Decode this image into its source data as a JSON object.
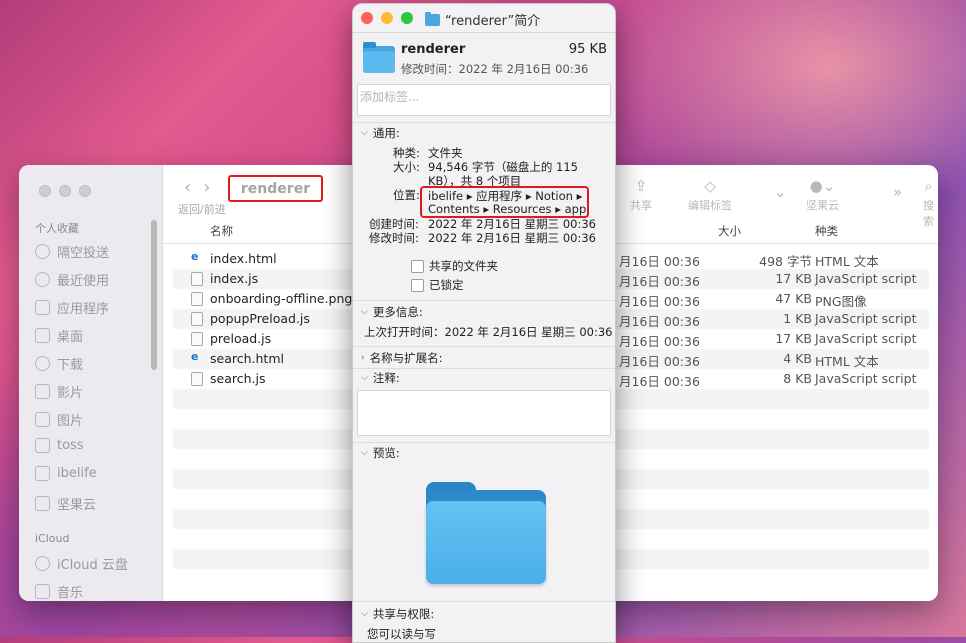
{
  "finder": {
    "title": "renderer",
    "nav_label": "返回/前进",
    "toolbar": {
      "share": "共享",
      "tags": "编辑标签",
      "cloud": "坚果云",
      "search": "搜索"
    },
    "sidebar": {
      "favorites_header": "个人收藏",
      "favorites": [
        "隔空投送",
        "最近使用",
        "应用程序",
        "桌面",
        "下载",
        "影片",
        "图片",
        "toss",
        "ibelife",
        "坚果云"
      ],
      "icloud_header": "iCloud",
      "icloud": [
        "iCloud 云盘",
        "音乐"
      ]
    },
    "columns": {
      "name": "名称",
      "size": "大小",
      "kind": "种类"
    },
    "files": [
      {
        "name": "index.html",
        "date": "月16日 00:36",
        "size": "498 字节",
        "kind": "HTML 文本"
      },
      {
        "name": "index.js",
        "date": "月16日 00:36",
        "size": "17 KB",
        "kind": "JavaScript script"
      },
      {
        "name": "onboarding-offline.png",
        "date": "月16日 00:36",
        "size": "47 KB",
        "kind": "PNG图像"
      },
      {
        "name": "popupPreload.js",
        "date": "月16日 00:36",
        "size": "1 KB",
        "kind": "JavaScript script"
      },
      {
        "name": "preload.js",
        "date": "月16日 00:36",
        "size": "17 KB",
        "kind": "JavaScript script"
      },
      {
        "name": "search.html",
        "date": "月16日 00:36",
        "size": "4 KB",
        "kind": "HTML 文本"
      },
      {
        "name": "search.js",
        "date": "月16日 00:36",
        "size": "8 KB",
        "kind": "JavaScript script"
      }
    ]
  },
  "info": {
    "title": "“renderer”简介",
    "name": "renderer",
    "size": "95 KB",
    "modified_header": "修改时间：2022 年 2月16日 00:36",
    "tags_placeholder": "添加标签...",
    "general": {
      "header": "通用:",
      "kind_label": "种类:",
      "kind": "文件夹",
      "size_label": "大小:",
      "size_line1": "94,546 字节（磁盘上的 115",
      "size_line2": "KB），共 8 个项目",
      "where_label": "位置:",
      "where_line1": "ibelife ▸ 应用程序 ▸ Notion ▸",
      "where_line2": "Contents ▸ Resources ▸ app",
      "created_label": "创建时间:",
      "created": "2022 年 2月16日 星期三 00:36",
      "modified_label": "修改时间:",
      "modified": "2022 年 2月16日 星期三 00:36",
      "shared_folder": "共享的文件夹",
      "locked": "已锁定"
    },
    "more_info": {
      "header": "更多信息:",
      "last_opened": "上次打开时间：2022 年 2月16日 星期三 00:36"
    },
    "name_ext_header": "名称与扩展名:",
    "comments_header": "注释:",
    "preview_header": "预览:",
    "sharing": {
      "header": "共享与权限:",
      "line": "您可以读与写"
    }
  }
}
